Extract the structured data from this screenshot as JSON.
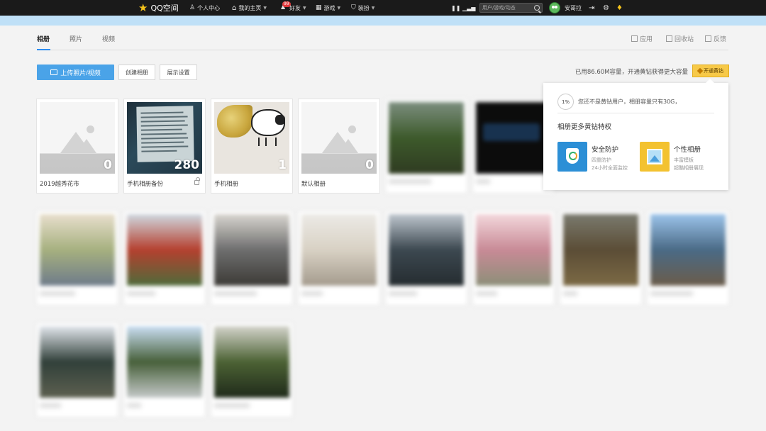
{
  "topbar": {
    "logo": "QQ空间",
    "personal_center": "个人中心",
    "my_home": "我的主页",
    "friends": "好友",
    "friends_badge": "99",
    "games": "游戏",
    "dressup": "装扮",
    "search_placeholder": "用户/游戏/动态",
    "username": "安哥拉"
  },
  "tabs": [
    "相册",
    "照片",
    "视频"
  ],
  "right_links": [
    "应用",
    "回收站",
    "反馈"
  ],
  "actions": {
    "upload": "上传照片/视频",
    "create": "创建相册",
    "display_settings": "展示设置"
  },
  "storage": {
    "text": "已用86.60M容量，开通黄钻获得更大容量",
    "vip_button": "开通黄钻"
  },
  "albums": [
    {
      "title": "2019越秀花市",
      "count": "0"
    },
    {
      "title": "手机相册备份",
      "count": "280"
    },
    {
      "title": "手机相册",
      "count": "1"
    },
    {
      "title": "默认相册",
      "count": "0"
    }
  ],
  "popup": {
    "percent": "1%",
    "note": "您还不是黄钻用户，相册容量只有30G，",
    "heading": "相册更多黄钻特权",
    "features": [
      {
        "title": "安全防护",
        "sub1": "四重防护",
        "sub2": "24小时全面监控"
      },
      {
        "title": "个性相册",
        "sub1": "丰富模板",
        "sub2": "超酷相册展现"
      }
    ]
  },
  "colors": {
    "accent": "#4aa3e8",
    "vip_yellow": "#f7c948",
    "topbar": "#1a1a1a"
  }
}
